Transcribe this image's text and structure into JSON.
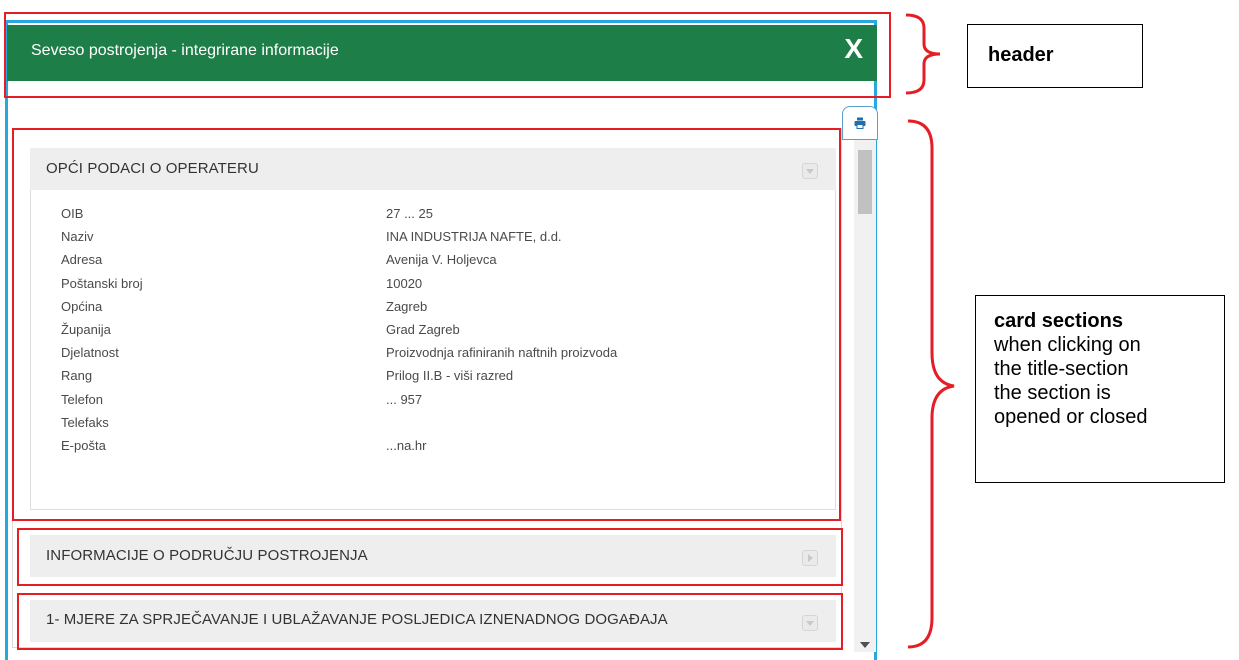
{
  "dialog": {
    "title": "Seveso postrojenja - integrirane informacije",
    "close_label": "X",
    "header_color": "#1e7e48",
    "frame_color": "#29a8e0"
  },
  "print_icon": "printer-icon",
  "sections": [
    {
      "title": "OPĆI PODACI O OPERATERU",
      "state": "open",
      "rows": [
        {
          "label": "OIB",
          "value": "27 ... 25"
        },
        {
          "label": "Naziv",
          "value": "INA INDUSTRIJA NAFTE, d.d."
        },
        {
          "label": "Adresa",
          "value": "Avenija V. Holjevca"
        },
        {
          "label": "Poštanski broj",
          "value": "10020"
        },
        {
          "label": "Općina",
          "value": "Zagreb"
        },
        {
          "label": "Županija",
          "value": "Grad Zagreb"
        },
        {
          "label": "Djelatnost",
          "value": "Proizvodnja rafiniranih naftnih proizvoda"
        },
        {
          "label": "Rang",
          "value": "Prilog II.B - viši razred"
        },
        {
          "label": "Telefon",
          "value": "... 957"
        },
        {
          "label": "Telefaks",
          "value": ""
        },
        {
          "label": "E-pošta",
          "value": "...na.hr"
        }
      ]
    },
    {
      "title": "INFORMACIJE O PODRUČJU POSTROJENJA",
      "state": "closed"
    },
    {
      "title": "1- MJERE ZA SPRJEČAVANJE I UBLAŽAVANJE POSLJEDICA IZNENADNOG DOGAĐAJA",
      "state": "closed"
    }
  ],
  "annotations": {
    "header_label": "header",
    "cards_title": "card sections",
    "cards_text": [
      "when clicking on",
      "the title-section",
      "the section is",
      "opened or closed"
    ],
    "highlight_color": "#e51e25"
  }
}
